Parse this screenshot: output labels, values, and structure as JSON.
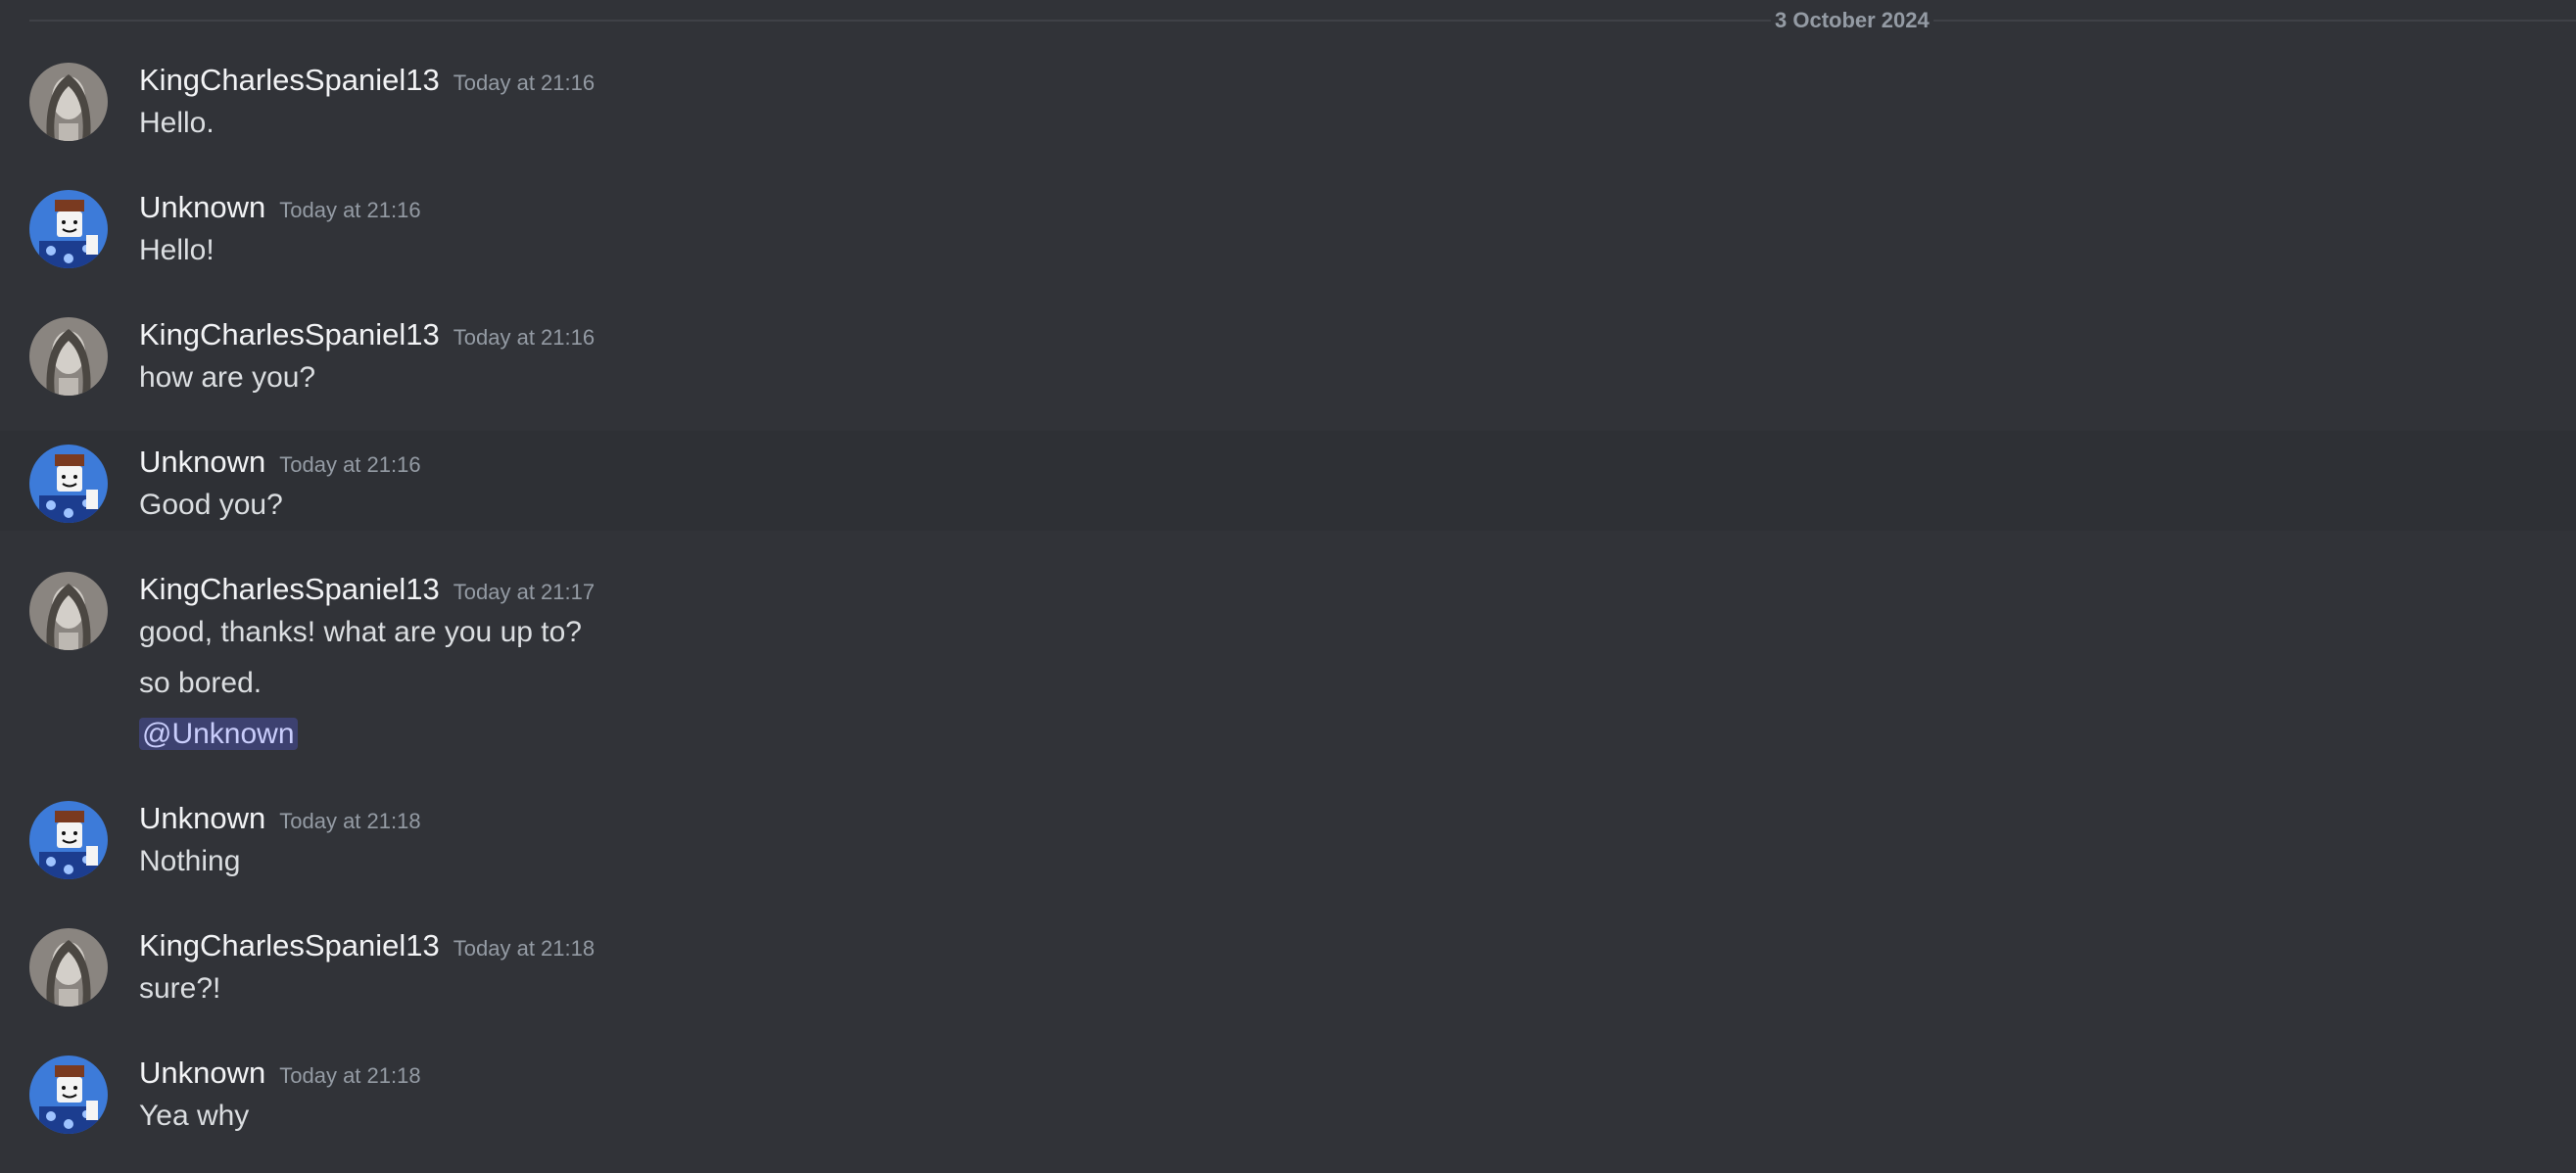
{
  "date_divider": "3 October 2024",
  "messages": [
    {
      "author": "KingCharlesSpaniel13",
      "time": "Today at 21:16",
      "lines": [
        "Hello."
      ]
    },
    {
      "author": "Unknown",
      "time": "Today at 21:16",
      "lines": [
        "Hello!"
      ]
    },
    {
      "author": "KingCharlesSpaniel13",
      "time": "Today at 21:16",
      "lines": [
        "how are you?"
      ]
    },
    {
      "author": "Unknown",
      "time": "Today at 21:16",
      "lines": [
        "Good you?"
      ]
    },
    {
      "author": "KingCharlesSpaniel13",
      "time": "Today at 21:17",
      "lines": [
        "good, thanks! what are you up to?",
        "so bored."
      ],
      "mention": "@Unknown"
    },
    {
      "author": "Unknown",
      "time": "Today at 21:18",
      "lines": [
        "Nothing"
      ]
    },
    {
      "author": "KingCharlesSpaniel13",
      "time": "Today at 21:18",
      "lines": [
        "sure?!"
      ]
    },
    {
      "author": "Unknown",
      "time": "Today at 21:18",
      "lines": [
        "Yea why"
      ]
    }
  ]
}
